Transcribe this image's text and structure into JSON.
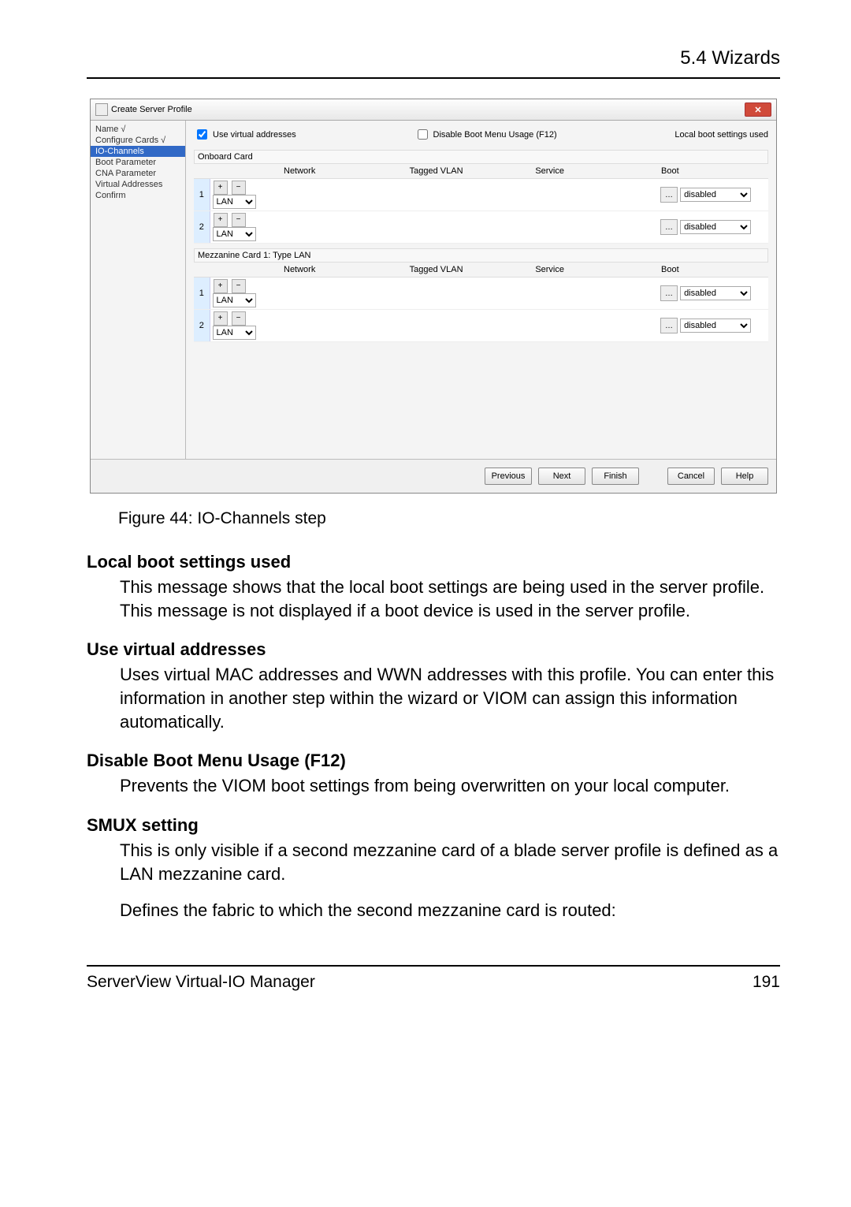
{
  "header": {
    "section": "5.4 Wizards"
  },
  "wizard": {
    "title": "Create Server Profile",
    "nav": [
      {
        "label": "Name √",
        "sel": false
      },
      {
        "label": "Configure Cards √",
        "sel": false
      },
      {
        "label": "IO-Channels",
        "sel": true
      },
      {
        "label": "Boot Parameter",
        "sel": false
      },
      {
        "label": "CNA Parameter",
        "sel": false
      },
      {
        "label": "Virtual Addresses",
        "sel": false
      },
      {
        "label": "Confirm",
        "sel": false
      }
    ],
    "use_virtual": "Use virtual addresses",
    "disable_boot_menu": "Disable Boot Menu Usage (F12)",
    "local_boot_used": "Local boot settings used",
    "onboard_label": "Onboard Card",
    "mezz_label": "Mezzanine Card 1: Type LAN",
    "cols": {
      "network": "Network",
      "tagged": "Tagged VLAN",
      "service": "Service",
      "boot": "Boot"
    },
    "type_options": [
      "LAN"
    ],
    "boot_options": [
      "disabled"
    ],
    "onboard_rows": [
      {
        "n": "1",
        "type": "LAN",
        "boot": "disabled"
      },
      {
        "n": "2",
        "type": "LAN",
        "boot": "disabled"
      }
    ],
    "mezz_rows": [
      {
        "n": "1",
        "type": "LAN",
        "boot": "disabled"
      },
      {
        "n": "2",
        "type": "LAN",
        "boot": "disabled"
      }
    ],
    "buttons": {
      "prev": "Previous",
      "next": "Next",
      "finish": "Finish",
      "cancel": "Cancel",
      "help": "Help"
    }
  },
  "figure_caption": "Figure 44: IO-Channels step",
  "doc": {
    "t1": "Local boot settings used",
    "d1": "This message shows that the local boot settings are being used in the server profile. This message is not displayed if a boot device is used in the server profile.",
    "t2": "Use virtual addresses",
    "d2": "Uses virtual MAC addresses and WWN addresses with this profile. You can enter this information in another step within the wizard or VIOM can assign this information automatically.",
    "t3": "Disable Boot Menu Usage (F12)",
    "d3": "Prevents the VIOM boot settings from being overwritten on your local computer.",
    "t4": "SMUX setting",
    "d4a": "This is only visible if a second mezzanine card of a blade server profile is defined as a LAN mezzanine card.",
    "d4b": "Defines the fabric to which the second mezzanine card is routed:"
  },
  "footer": {
    "product": "ServerView Virtual-IO Manager",
    "page": "191"
  }
}
